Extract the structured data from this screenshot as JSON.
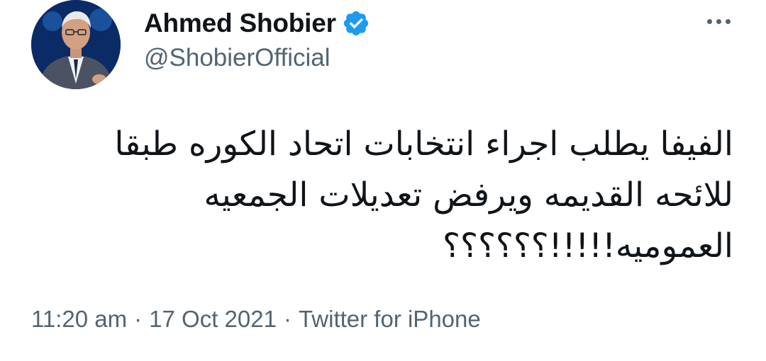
{
  "author": {
    "display_name": "Ahmed Shobier",
    "handle": "@ShobierOfficial",
    "verified": true
  },
  "tweet": {
    "text": "الفيفا يطلب اجراء انتخابات اتحاد الكوره طبقا\nللائحه القديمه ويرفض تعديلات الجمعيه\nالعموميه!!!!!؟؟؟؟؟؟"
  },
  "meta": {
    "time": "11:20 am",
    "separator": "·",
    "date": "17 Oct 2021",
    "source": "Twitter for iPhone"
  },
  "colors": {
    "text": "#0f1419",
    "secondary": "#536471",
    "verified_blue": "#1d9bf0"
  }
}
